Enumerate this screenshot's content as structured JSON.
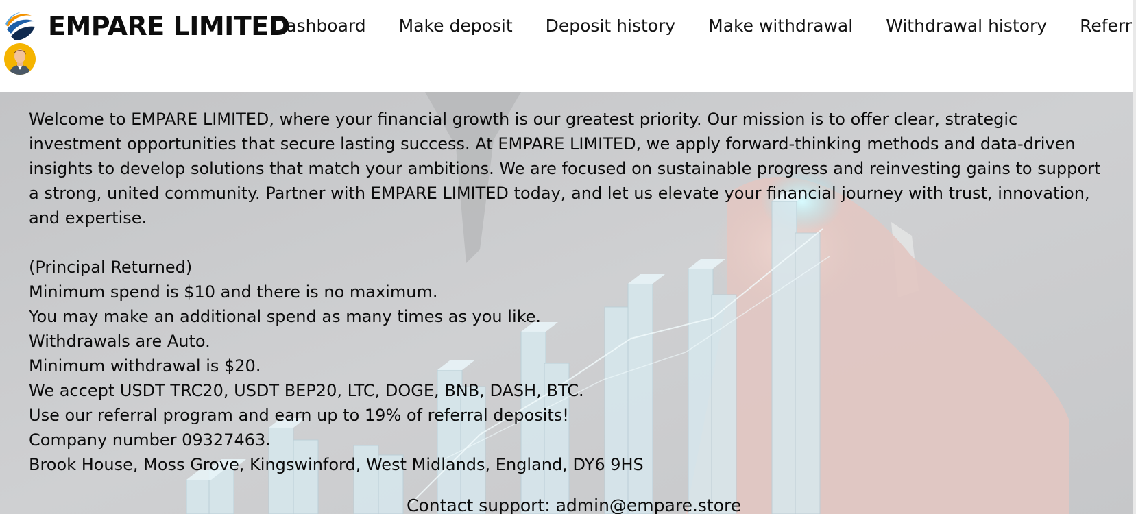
{
  "brand": {
    "name": "EMPARE LIMITED",
    "logo_icon": "swoosh-globe-icon",
    "logo_colors": [
      "#f39200",
      "#1d5fa8",
      "#0f2a4f"
    ]
  },
  "nav": {
    "items": [
      {
        "label": "Dashboard"
      },
      {
        "label": "Make deposit"
      },
      {
        "label": "Deposit history"
      },
      {
        "label": "Make withdrawal"
      },
      {
        "label": "Withdrawal history"
      },
      {
        "label": "Referrals"
      }
    ]
  },
  "user": {
    "avatar_icon": "user-avatar-icon",
    "avatar_color": "#f5b400"
  },
  "hero": {
    "intro": "Welcome to EMPARE LIMITED, where your financial growth is our greatest priority. Our mission is to offer clear, strategic investment opportunities that secure lasting success. At EMPARE LIMITED, we apply forward-thinking methods and data-driven insights to develop solutions that match your ambitions. We are focused on sustainable progress and reinvesting gains to support a strong, united community. Partner with EMPARE LIMITED today, and let us elevate your financial journey with trust, innovation, and expertise.",
    "features": [
      "(Principal Returned)",
      "Minimum spend is $10 and there is no maximum.",
      "You may make an additional spend as many times as you like.",
      "Withdrawals are Auto.",
      "Minimum withdrawal is $20.",
      "We accept USDT TRC20, USDT BEP20, LTC, DOGE, BNB, DASH, BTC.",
      "Use our referral program and earn up to 19% of referral deposits!",
      "Company number 09327463.",
      "Brook House, Moss Grove, Kingswinford, West Midlands, England, DY6 9HS"
    ],
    "background_image": "hand-pointing-at-growth-chart-photo"
  },
  "contact": {
    "label": "Contact support:",
    "email": "admin@empare.store"
  }
}
